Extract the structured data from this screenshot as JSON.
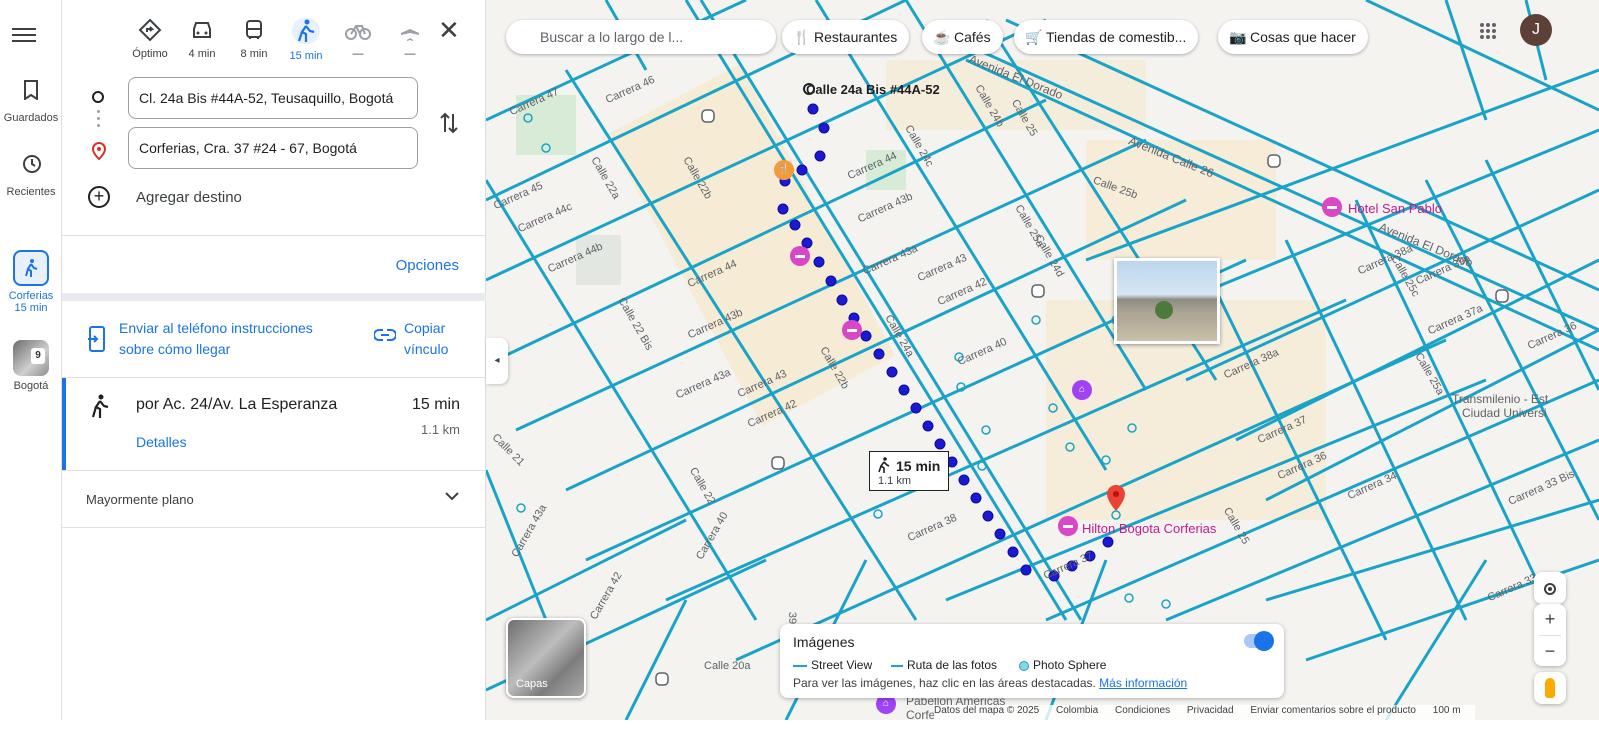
{
  "rail": {
    "saved": "Guardados",
    "recent": "Recientes",
    "trip_title": "Corferias",
    "trip_time": "15 min",
    "city": "Bogotá",
    "photo_badge": "9"
  },
  "modes": [
    {
      "label": "Óptimo",
      "icon": "directions-icon"
    },
    {
      "label": "4 min",
      "icon": "car-icon"
    },
    {
      "label": "8 min",
      "icon": "bus-icon"
    },
    {
      "label": "15 min",
      "icon": "walk-icon",
      "active": true
    },
    {
      "label": "—",
      "icon": "bike-icon"
    },
    {
      "label": "—",
      "icon": "flight-icon"
    }
  ],
  "directions": {
    "origin": "Cl. 24a Bis #44A-52, Teusaquillo, Bogotá",
    "destination": "Corferias, Cra. 37 #24 - 67, Bogotá",
    "add_destination": "Agregar destino",
    "options": "Opciones",
    "send_phone": "Enviar al teléfono instrucciones sobre cómo llegar",
    "copy_link": "Copiar vínculo"
  },
  "route": {
    "via": "por Ac. 24/Av. La Esperanza",
    "time": "15 min",
    "distance": "1.1 km",
    "details": "Detalles",
    "terrain": "Mayormente plano"
  },
  "map": {
    "search_placeholder": "Buscar a lo largo de l...",
    "chips": [
      {
        "label": "Restaurantes",
        "icon": "fork-knife-icon"
      },
      {
        "label": "Cafés",
        "icon": "coffee-icon"
      },
      {
        "label": "Tiendas de comestib...",
        "icon": "cart-icon"
      },
      {
        "label": "Cosas que hacer",
        "icon": "camera-icon"
      }
    ],
    "avatar_initial": "J",
    "start_label": "Calle 24a Bis #44A-52",
    "bubble_time": "15 min",
    "bubble_distance": "1.1 km",
    "labels": {
      "carrera47": "Carrera 47",
      "carrera46": "Carrera 46",
      "carrera45": "Carrera 45",
      "carrera44c": "Carrera 44c",
      "carrera44b": "Carrera 44b",
      "carrera44": "Carrera 44",
      "carrera43b": "Carrera 43b",
      "carrera43a": "Carrera 43a",
      "carrera43": "Carrera 43",
      "carrera42": "Carrera 42",
      "carrera42b": "Carrera 42",
      "carrera40": "Carrera 40",
      "carrera38": "Carrera 38",
      "carrera37": "Carrera 37",
      "carrera36": "Carrera 36",
      "carrera34": "Carrera 34",
      "carrera33": "Carrera 33",
      "carrera39a": "Carrera 39a",
      "carrera38a": "Carrera 38a",
      "carrera37a": "Carrera 37a",
      "carrera43a2": "Carrera 43a",
      "carrera44_2": "Carrera 44",
      "carrera43b2": "Carrera 43b",
      "carrera43_2": "Carrera 43",
      "carrera42_2": "Carrera 42",
      "carrera36_2": "Carrera 36",
      "carrera37_2": "Carrera 37",
      "carrera33bis": "Carrera 33 Bis",
      "calle24c": "Calle 24c",
      "calle24a": "Calle 24a",
      "calle24b": "Calle 24b",
      "calle24d": "Calle 24d",
      "calle25": "Calle 25",
      "calle25b": "Calle 25b",
      "calle25a": "Calle 25a",
      "calle25c": "Calle 25c",
      "calle22b": "Calle 22b",
      "calle22a": "Calle 22a",
      "calle22bis": "Calle 22 Bis",
      "calle22": "Calle 22",
      "calle21": "Calle 21",
      "calle20a": "Calle 20a",
      "calle25_2": "Calle 25",
      "calle25a2": "Calle 25a",
      "calle39": "39",
      "avEldorado": "Avenida El Dorado",
      "avEldorado2": "Avenida El Dorado",
      "avCalle26": "Avenida Calle 26",
      "transmilenio": "Transmilenio - Est",
      "ciudadUni": "Ciudad Universi",
      "pabellon": "Pabellón Américas",
      "corfe": "Corfe"
    },
    "hotel_san_pablo": "Hotel San Pablo",
    "hilton": "Hilton Bogota Corferias",
    "layers_label": "Capas",
    "images_panel": {
      "title": "Imágenes",
      "street_view": "Street View",
      "photo_route": "Ruta de las fotos",
      "photo_sphere": "Photo Sphere",
      "hint": "Para ver las imágenes, haz clic en las áreas destacadas.",
      "more": "Más información"
    },
    "footer": {
      "data": "Datos del mapa © 2025",
      "country": "Colombia",
      "terms": "Condiciones",
      "privacy": "Privacidad",
      "feedback": "Enviar comentarios sobre el producto",
      "scale": "100 m"
    },
    "colors": {
      "street_view": "#1aa3c8",
      "route": "#1a1ad6",
      "accent": "#1a73e8",
      "poi": "#d946c8"
    }
  }
}
